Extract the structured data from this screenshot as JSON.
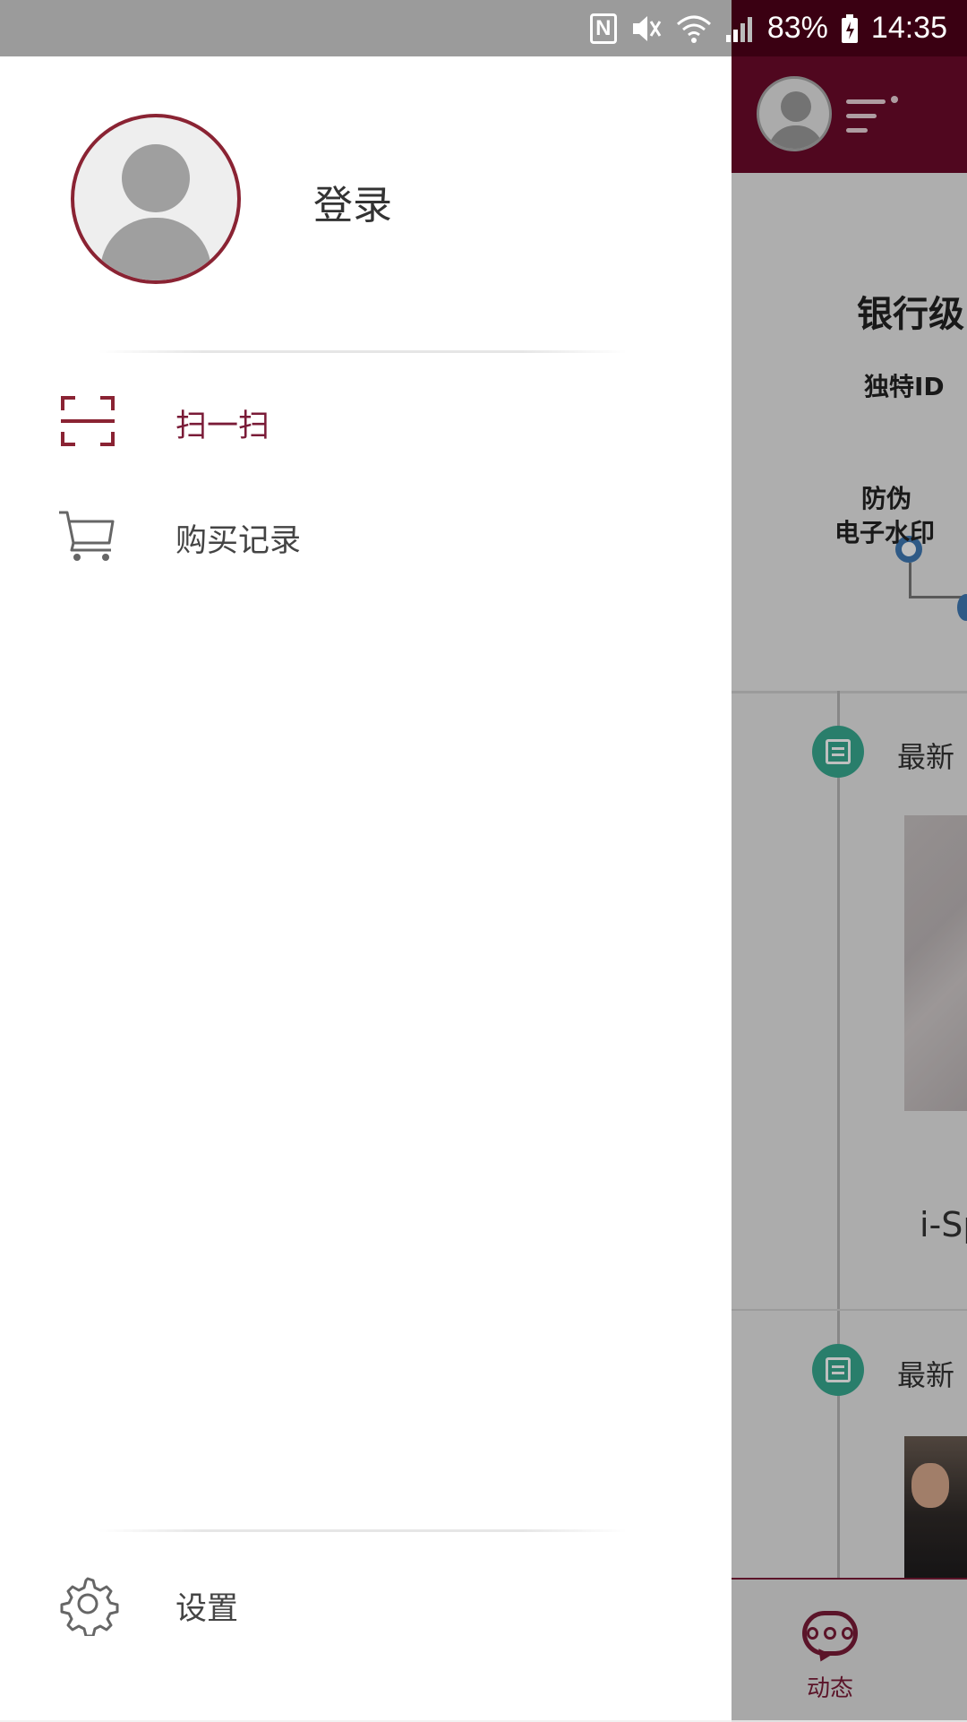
{
  "status_bar": {
    "nfc": "N",
    "battery": "83%",
    "time": "14:35"
  },
  "drawer": {
    "login_label": "登录",
    "menu": [
      {
        "label": "扫一扫",
        "icon": "scan-icon",
        "active": true
      },
      {
        "label": "购买记录",
        "icon": "cart-icon",
        "active": false
      }
    ],
    "settings_label": "设置"
  },
  "background_app": {
    "banner_title": "银行级",
    "label_id": "独特ID",
    "label_watermark_line1": "防伪",
    "label_watermark_line2": "电子水印",
    "news_1_title": "最新",
    "news_1_caption": "i-Sp",
    "news_2_title": "最新",
    "bottom_tab_label": "动态"
  },
  "colors": {
    "accent": "#7a1b37",
    "header": "#6b0a2a",
    "badge": "#37a88f"
  }
}
